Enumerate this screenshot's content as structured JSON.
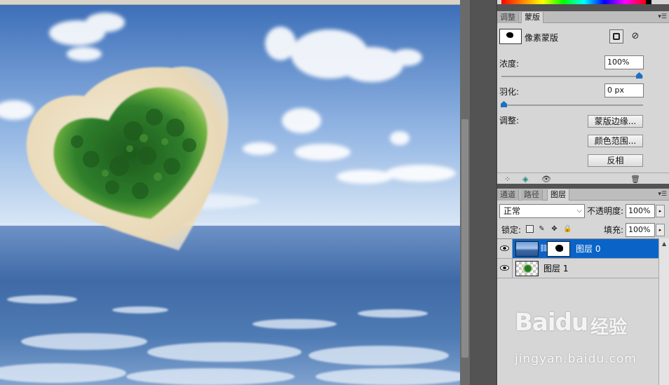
{
  "masks_panel": {
    "tabs": [
      "调整",
      "蒙版"
    ],
    "active_tab": "蒙版",
    "mask_type_label": "像素蒙版",
    "density_label": "浓度:",
    "density_value": "100%",
    "density_level": 1.0,
    "feather_label": "羽化:",
    "feather_value": "0 px",
    "feather_level": 0.0,
    "refine_label": "调整:",
    "mask_edge_button": "蒙版边缘...",
    "color_range_button": "颜色范围...",
    "invert_button": "反相"
  },
  "layers_panel": {
    "tabs": [
      "通道",
      "路径",
      "图层"
    ],
    "active_tab": "图层",
    "blend_mode": "正常",
    "opacity_label": "不透明度:",
    "opacity_value": "100%",
    "lock_label": "锁定:",
    "fill_label": "填充:",
    "fill_value": "100%",
    "layers": [
      {
        "name": "图层 0",
        "selected": true,
        "has_mask": true
      },
      {
        "name": "图层 1",
        "selected": false,
        "has_mask": false
      }
    ]
  },
  "icons": {
    "panel_menu": "panel-menu-icon",
    "vector_mask": "vector-mask-icon",
    "load_selection": "load-selection-icon",
    "apply_mask": "apply-mask-icon",
    "visibility": "eye-icon",
    "delete_mask": "trash-icon",
    "lock_transparent": "lock-transparent-icon",
    "lock_paint": "brush-icon",
    "lock_position": "move-icon",
    "lock_all": "lock-icon",
    "link": "chain-link-icon"
  },
  "colors": {
    "selection_blue": "#0a64c8",
    "slider_blue": "#1f6fc3",
    "panel_gray": "#d6d6d6"
  },
  "watermark": {
    "logo": "Baidu",
    "logo_cn": "经验",
    "url": "jingyan.baidu.com"
  }
}
